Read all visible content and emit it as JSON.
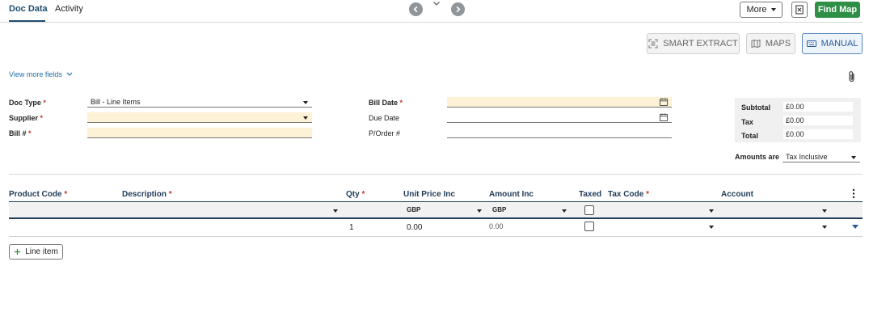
{
  "tabs": [
    {
      "label": "Doc Data"
    },
    {
      "label": "Activity"
    }
  ],
  "header": {
    "more_label": "More",
    "find_map_label": "Find Map",
    "accent_color": "#2f8f46"
  },
  "modes": [
    {
      "label": "SMART EXTRACT"
    },
    {
      "label": "MAPS"
    },
    {
      "label": "MANUAL"
    }
  ],
  "view_more_label": "View more fields",
  "form": {
    "doc_type": {
      "label": "Doc Type",
      "value": "Bill - Line Items"
    },
    "supplier": {
      "label": "Supplier",
      "value": ""
    },
    "bill_no": {
      "label": "Bill #",
      "value": ""
    },
    "bill_date": {
      "label": "Bill Date",
      "value": ""
    },
    "due_date": {
      "label": "Due Date",
      "value": ""
    },
    "po_number": {
      "label": "P/Order #",
      "value": ""
    }
  },
  "totals": {
    "subtotal_label": "Subtotal",
    "subtotal": "£0.00",
    "tax_label": "Tax",
    "tax": "£0.00",
    "total_label": "Total",
    "total": "£0.00",
    "amounts_are_label": "Amounts are",
    "amounts_are_value": "Tax Inclusive"
  },
  "table": {
    "columns": {
      "product_code": "Product Code",
      "description": "Description",
      "qty": "Qty",
      "unit_price": "Unit Price Inc",
      "amount": "Amount Inc",
      "taxed": "Taxed",
      "tax_code": "Tax Code",
      "account": "Account"
    },
    "filters": {
      "unit_price_currency": "GBP",
      "amount_currency": "GBP"
    },
    "rows": [
      {
        "qty": "1",
        "unit_price": "0.00",
        "amount": "0.00",
        "taxed": false
      }
    ]
  },
  "add_line_label": "Line item"
}
